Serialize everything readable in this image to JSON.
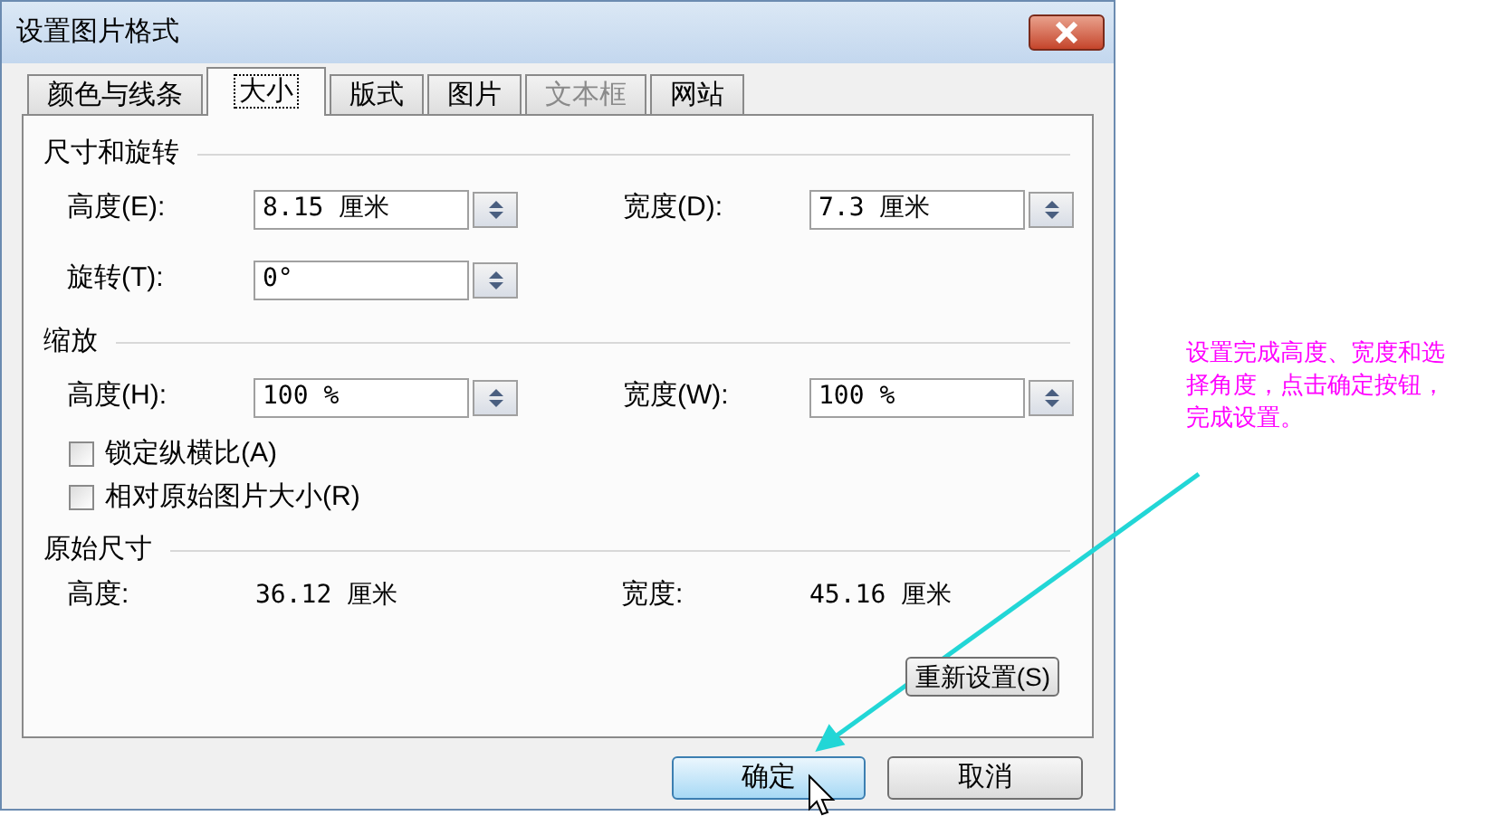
{
  "window": {
    "title": "设置图片格式"
  },
  "tabs": [
    {
      "label": "颜色与线条",
      "selected": false,
      "disabled": false
    },
    {
      "label": "大小",
      "selected": true,
      "disabled": false
    },
    {
      "label": "版式",
      "selected": false,
      "disabled": false
    },
    {
      "label": "图片",
      "selected": false,
      "disabled": false
    },
    {
      "label": "文本框",
      "selected": false,
      "disabled": true
    },
    {
      "label": "网站",
      "selected": false,
      "disabled": false
    }
  ],
  "size_rotate": {
    "title": "尺寸和旋转",
    "rows": [
      [
        {
          "label": "高度(E):",
          "value": "8.15 厘米"
        },
        {
          "label": "宽度(D):",
          "value": "7.3 厘米"
        }
      ],
      [
        {
          "label": "旋转(T):",
          "value": "0°"
        }
      ]
    ]
  },
  "scale": {
    "title": "缩放",
    "rows": [
      [
        {
          "label": "高度(H):",
          "value": "100 %"
        },
        {
          "label": "宽度(W):",
          "value": "100 %"
        }
      ]
    ],
    "checkboxes": [
      {
        "label": "锁定纵横比(A)",
        "checked": false
      },
      {
        "label": "相对原始图片大小(R)",
        "checked": false
      }
    ]
  },
  "original_size": {
    "title": "原始尺寸",
    "readings": [
      {
        "label": "高度:",
        "value": "36.12 厘米"
      },
      {
        "label": "宽度:",
        "value": "45.16 厘米"
      }
    ]
  },
  "reset_button": {
    "label": "重新设置(S)"
  },
  "buttons": [
    {
      "label": "确定",
      "default": true
    },
    {
      "label": "取消",
      "default": false
    }
  ],
  "annotation": {
    "text": "设置完成高度、宽度和选择角度，点击确定按钮，完成设置。"
  }
}
